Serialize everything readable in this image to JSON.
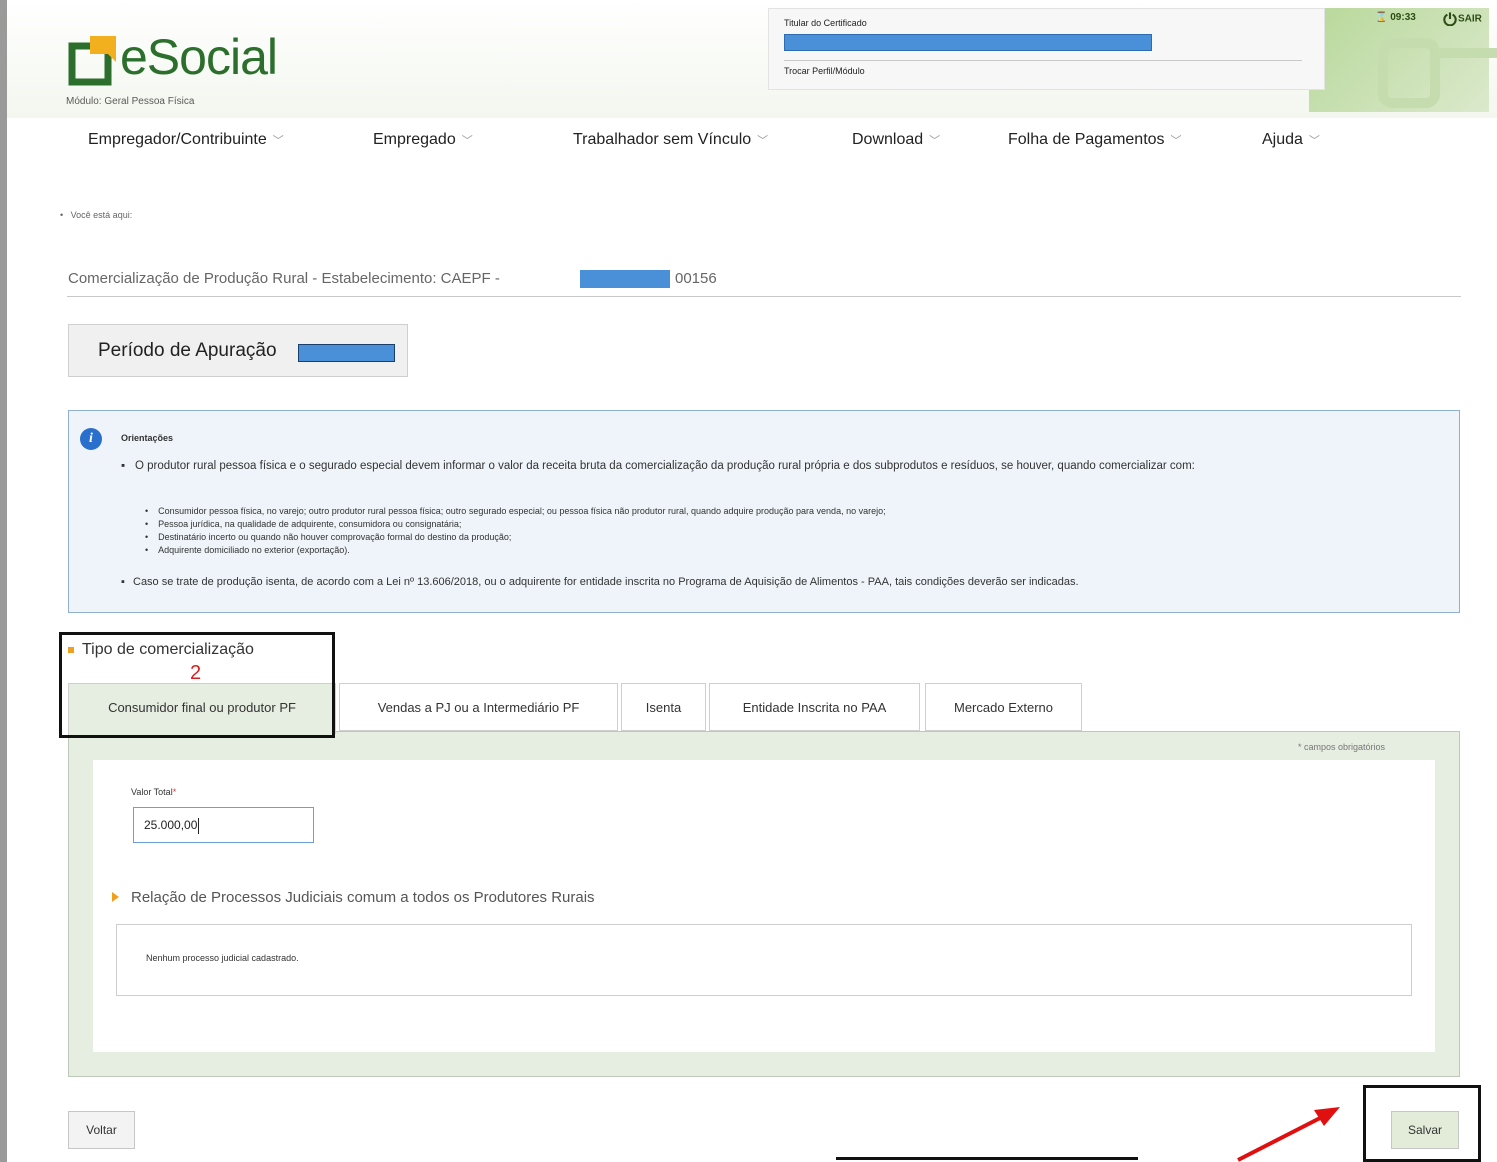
{
  "header": {
    "logo_text": "eSocial",
    "module": "Módulo: Geral Pessoa Física",
    "certificate_label": "Titular do Certificado",
    "switch_profile": "Trocar Perfil/Módulo",
    "session_time": "09:33",
    "exit_label": "SAIR"
  },
  "menu": [
    {
      "label": "Empregador/Contribuinte"
    },
    {
      "label": "Empregado"
    },
    {
      "label": "Trabalhador sem Vínculo"
    },
    {
      "label": "Download"
    },
    {
      "label": "Folha de Pagamentos"
    },
    {
      "label": "Ajuda"
    }
  ],
  "breadcrumb": "Você está aqui:",
  "page": {
    "title_prefix": "Comercialização de Produção Rural - Estabelecimento: CAEPF -",
    "title_suffix": "00156",
    "period_label": "Período de Apuração"
  },
  "orientacoes": {
    "title": "Orientações",
    "p1": "O produtor rural pessoa física e o segurado especial devem informar o valor da receita bruta da comercialização da produção rural própria e dos subprodutos e resíduos, se houver, quando comercializar com:",
    "items": [
      "Consumidor pessoa física, no varejo; outro produtor rural pessoa física; outro segurado especial; ou pessoa física não produtor rural, quando adquire produção para venda, no varejo;",
      "Pessoa jurídica, na qualidade de adquirente, consumidora ou consignatária;",
      "Destinatário incerto ou quando não houver comprovação formal do destino da produção;",
      "Adquirente domiciliado no exterior (exportação)."
    ],
    "p2": "Caso se trate de produção isenta, de acordo com a Lei nº 13.606/2018, ou o adquirente for entidade inscrita no Programa de Aquisição de Alimentos - PAA, tais condições deverão ser indicadas."
  },
  "tipo": {
    "label": "Tipo de comercialização",
    "annotation": "2",
    "tabs": [
      {
        "label": "Consumidor final ou produtor PF"
      },
      {
        "label": "Vendas a PJ ou a Intermediário PF"
      },
      {
        "label": "Isenta"
      },
      {
        "label": "Entidade Inscrita no PAA"
      },
      {
        "label": "Mercado Externo"
      }
    ]
  },
  "form": {
    "required_note": "* campos obrigatórios",
    "valor_label": "Valor Total",
    "required_star": "*",
    "valor_value": "25.000,00",
    "processos_title": "Relação de Processos Judiciais comum a todos os Produtores Rurais",
    "processos_empty": "Nenhum processo judicial cadastrado."
  },
  "buttons": {
    "back": "Voltar",
    "save": "Salvar"
  },
  "colors": {
    "brand_green": "#2c6e2c",
    "redaction_blue": "#4a90d9",
    "annotation_red": "#e01010"
  }
}
